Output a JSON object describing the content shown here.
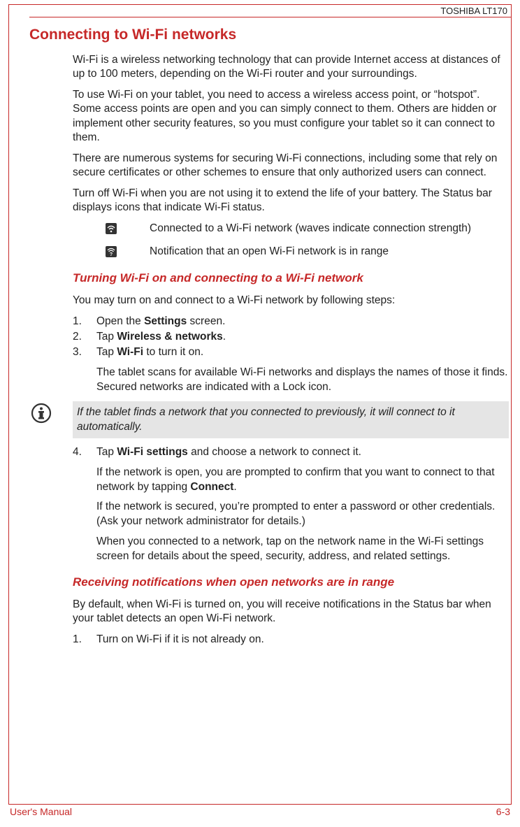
{
  "header": {
    "product": "TOSHIBA LT170"
  },
  "footer": {
    "left": "User's Manual",
    "right": "6-3"
  },
  "h1": "Connecting to Wi-Fi networks",
  "intro": {
    "p1": "Wi-Fi is a wireless networking technology that can provide Internet access at distances of up to 100 meters, depending on the Wi-Fi router and your surroundings.",
    "p2": "To use Wi-Fi on your tablet, you need to access a wireless access point, or “hotspot”. Some access points are open and you can simply connect to them. Others are hidden or implement other security features, so you must configure your tablet so it can connect to them.",
    "p3": "There are numerous systems for securing Wi-Fi connections, including some that rely on secure certificates or other schemes to ensure that only authorized users can connect.",
    "p4": "Turn off Wi-Fi when you are not using it to extend the life of your battery. The Status bar displays icons that indicate Wi-Fi status."
  },
  "icons": {
    "connected": "Connected to a Wi-Fi network (waves indicate connection strength)",
    "openNotify": "Notification that an open Wi-Fi network is in range"
  },
  "section1": {
    "heading": "Turning Wi-Fi on and connecting to a Wi-Fi network",
    "lead": "You may turn on and connect to a Wi-Fi network by following steps:",
    "steps": {
      "s1_num": "1.",
      "s1a": "Open the ",
      "s1b": "Settings",
      "s1c": " screen.",
      "s2_num": "2.",
      "s2a": "Tap ",
      "s2b": "Wireless & networks",
      "s2c": ".",
      "s3_num": "3.",
      "s3a": "Tap ",
      "s3b": "Wi-Fi",
      "s3c": " to turn it on.",
      "s3_sub": "The tablet scans for available Wi-Fi networks and displays the names of those it finds. Secured networks are indicated with a Lock icon.",
      "note": "If the tablet finds a network that you connected to previously, it will connect to it automatically.",
      "s4_num": "4.",
      "s4a": "Tap ",
      "s4b": "Wi-Fi settings",
      "s4c": " and choose a network to connect it.",
      "s4_sub1a": "If the network is open, you are prompted to confirm that you want to connect to that network by tapping ",
      "s4_sub1b": "Connect",
      "s4_sub1c": ".",
      "s4_sub2": "If the network is secured, you’re prompted to enter a password or other credentials. (Ask your network administrator for details.)",
      "s4_sub3": "When you connected to a network, tap on the network name in the Wi-Fi settings screen for details about the speed, security, address, and related settings."
    }
  },
  "section2": {
    "heading": "Receiving notifications when open networks are in range",
    "lead": "By default, when Wi-Fi is turned on, you will receive notifications in the Status bar when your tablet detects an open Wi-Fi network.",
    "s1_num": "1.",
    "s1": "Turn on Wi-Fi if it is not already on."
  }
}
